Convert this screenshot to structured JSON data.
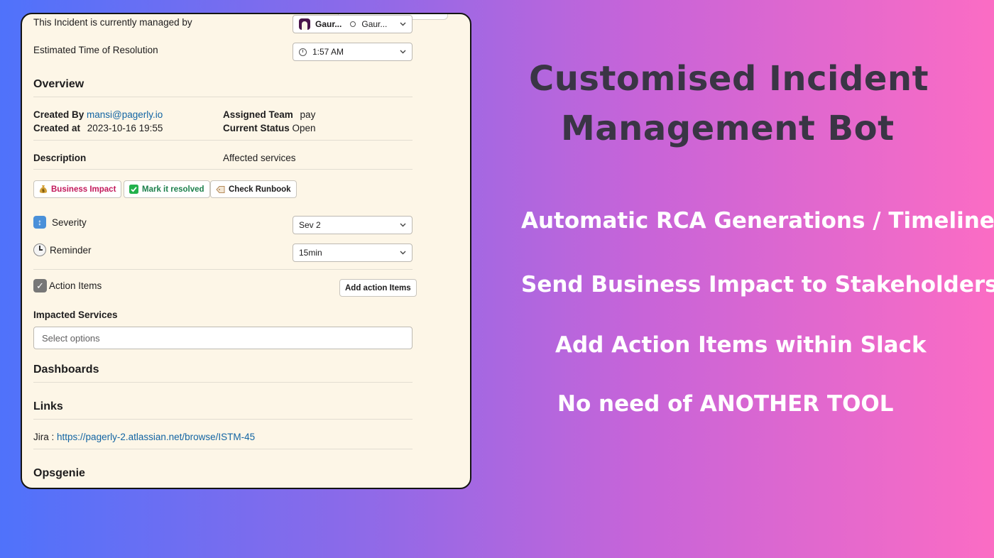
{
  "card": {
    "managed_by_label": "This Incident is currently managed by",
    "managed_by_user1": "Gaur...",
    "managed_by_user2": "Gaur...",
    "eta_label": "Estimated Time of Resolution",
    "eta_value": "1:57 AM",
    "overview_title": "Overview",
    "created_by_label": "Created By",
    "created_by_value": "mansi@pagerly.io",
    "created_at_label": "Created at",
    "created_at_value": "2023-10-16 19:55",
    "assigned_team_label": "Assigned Team",
    "assigned_team_value": "pay",
    "current_status_label": "Current Status",
    "current_status_value": "Open",
    "description_label": "Description",
    "affected_services_label": "Affected services",
    "buttons": {
      "business_impact": "Business Impact",
      "mark_resolved": "Mark it resolved",
      "check_runbook": "Check Runbook"
    },
    "severity_label": "Severity",
    "severity_value": "Sev 2",
    "reminder_label": "Reminder",
    "reminder_value": "15min",
    "action_items_label": "Action Items",
    "add_action_items": "Add action Items",
    "impacted_services_label": "Impacted Services",
    "impacted_services_placeholder": "Select options",
    "dashboards_title": "Dashboards",
    "links_title": "Links",
    "jira_label": "Jira :",
    "jira_url": "https://pagerly-2.atlassian.net/browse/ISTM-45",
    "opsgenie_title": "Opsgenie"
  },
  "promo": {
    "heading_line1": "Customised Incident",
    "heading_line2": "Management Bot",
    "features": [
      "Automatic RCA Generations / Timeline",
      "Send Business Impact to Stakeholders",
      "Add Action Items within Slack",
      "No need of ANOTHER TOOL"
    ]
  },
  "colors": {
    "heading": "#3a3545",
    "feature_text": "#ffffff",
    "card_bg": "#fdf6e7",
    "link": "#1264a3",
    "business_impact": "#c2185b",
    "mark_resolved": "#1b7f4b"
  },
  "icons": {
    "business_impact": "money-bag-icon",
    "mark_resolved": "check-mark-button-icon",
    "check_runbook": "label-tag-icon",
    "severity": "up-down-arrow-icon",
    "reminder": "alarm-clock-icon",
    "action_items": "checkbox-checked-icon",
    "eta": "clock-icon",
    "avatar": "user-avatar-icon"
  }
}
